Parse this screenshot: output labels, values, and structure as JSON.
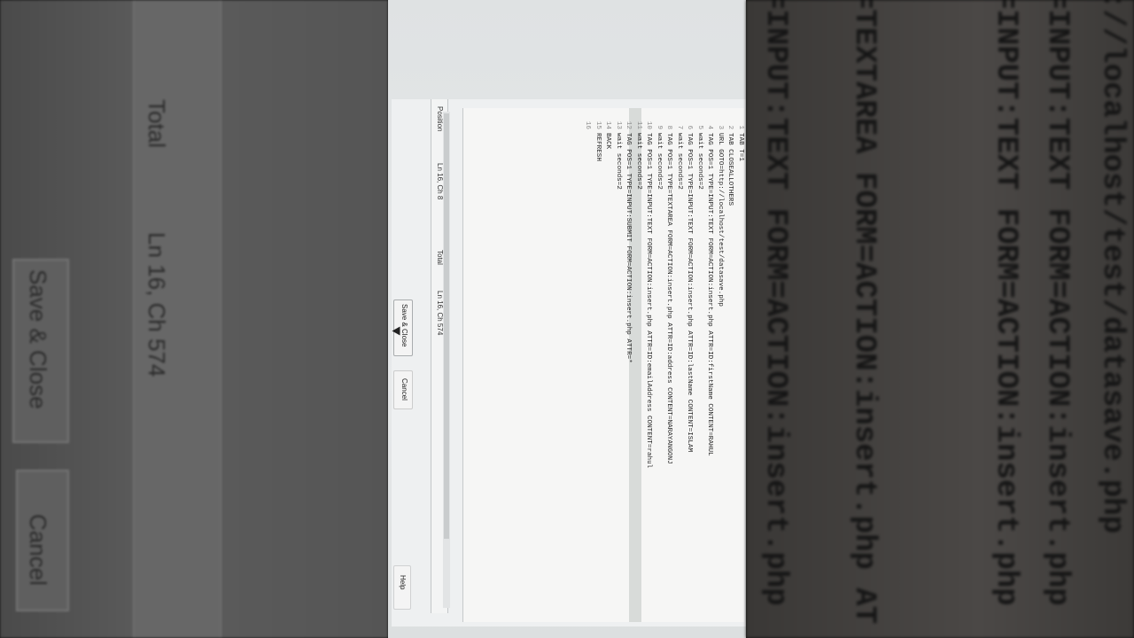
{
  "background_left": {
    "label_total": "Total",
    "label_position": "Ln 16, Ch 574",
    "label_save": "Save & Close",
    "label_cancel": "Cancel"
  },
  "background_right": {
    "lines": [
      "://localhost/test/datasave.php",
      "=INPUT:TEXT FORM=ACTION:insert.php",
      "=INPUT:TEXT FORM=ACTION:insert.php",
      "=TEXTAREA FORM=ACTION:insert.php AT",
      "=INPUT:TEXT FORM=ACTION:insert.php"
    ]
  },
  "editor": {
    "lines": [
      {
        "n": "1",
        "text": "TAB T=1"
      },
      {
        "n": "2",
        "text": "TAB CLOSEALLOTHERS"
      },
      {
        "n": "3",
        "text": "URL GOTO=http://localhost/test/datasave.php"
      },
      {
        "n": "4",
        "text": "TAG POS=1 TYPE=INPUT:TEXT FORM=ACTION:insert.php ATTR=ID:firstName CONTENT=RAHUL"
      },
      {
        "n": "5",
        "text": "wait seconds=2"
      },
      {
        "n": "6",
        "text": "TAG POS=1 TYPE=INPUT:TEXT FORM=ACTION:insert.php ATTR=ID:lastName CONTENT=ISLAM"
      },
      {
        "n": "7",
        "text": "wait seconds=2"
      },
      {
        "n": "8",
        "text": "TAG POS=1 TYPE=TEXTAREA FORM=ACTION:insert.php ATTR=ID:address CONTENT=NARAYANGONJ"
      },
      {
        "n": "9",
        "text": "wait seconds=2"
      },
      {
        "n": "10",
        "text": "TAG POS=1 TYPE=INPUT:TEXT FORM=ACTION:insert.php ATTR=ID:emailAddress CONTENT=rahul"
      },
      {
        "n": "11",
        "text": "wait seconds=2"
      },
      {
        "n": "12",
        "text": "TAG POS=1 TYPE=INPUT:SUBMIT FORM=ACTION:insert.php ATTR=*"
      },
      {
        "n": "13",
        "text": "wait seconds=2"
      },
      {
        "n": "14",
        "text": "BACK"
      },
      {
        "n": "15",
        "text": "REFRESH"
      },
      {
        "n": "16",
        "text": ""
      }
    ]
  },
  "status": {
    "position_label": "Position",
    "position_value": "Ln 16, Ch 8",
    "total_label": "Total",
    "total_value": "Ln 16, Ch 574"
  },
  "buttons": {
    "save_close": "Save & Close",
    "cancel": "Cancel",
    "help": "Help"
  }
}
